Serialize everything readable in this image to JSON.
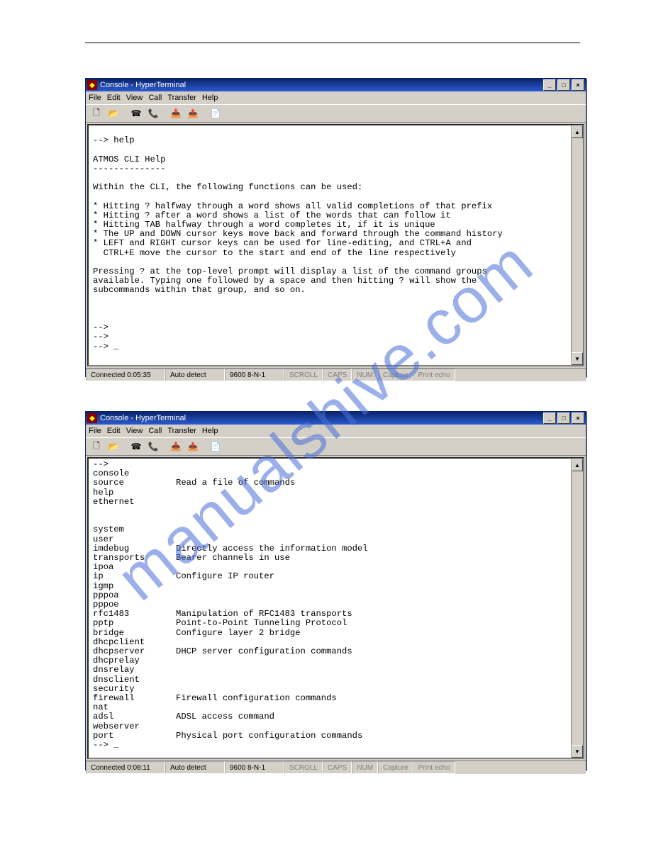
{
  "watermark": "manualshive.com",
  "window": {
    "title": "Console - HyperTerminal",
    "icon_char": "◆"
  },
  "menus": [
    "File",
    "Edit",
    "View",
    "Call",
    "Transfer",
    "Help"
  ],
  "toolbar_icons": [
    "new-icon",
    "open-icon",
    "connect-icon",
    "disconnect-icon",
    "send-icon",
    "receive-icon",
    "properties-icon"
  ],
  "toolbar_glyphs": [
    "🗋",
    "📂",
    "☎",
    "📞",
    "📥",
    "📤",
    "📄"
  ],
  "terminal1": "\n--> help\n\nATMOS CLI Help\n--------------\n\nWithin the CLI, the following functions can be used:\n\n* Hitting ? halfway through a word shows all valid completions of that prefix\n* Hitting ? after a word shows a list of the words that can follow it\n* Hitting TAB halfway through a word completes it, if it is unique\n* The UP and DOWN cursor keys move back and forward through the command history\n* LEFT and RIGHT cursor keys can be used for line-editing, and CTRL+A and\n  CTRL+E move the cursor to the start and end of the line respectively\n\nPressing ? at the top-level prompt will display a list of the command groups\navailable. Typing one followed by a space and then hitting ? will show the\nsubcommands within that group, and so on.\n\n\n\n-->\n-->\n--> _",
  "terminal2": "-->\nconsole\nsource          Read a file of commands\nhelp\nethernet\n\n\nsystem\nuser\nimdebug         Directly access the information model\ntransports      Bearer channels in use\nipoa\nip              Configure IP router\nigmp\npppoa\npppoe\nrfc1483         Manipulation of RFC1483 transports\npptp            Point-to-Point Tunneling Protocol\nbridge          Configure layer 2 bridge\ndhcpclient\ndhcpserver      DHCP server configuration commands\ndhcprelay\ndnsrelay\ndnsclient\nsecurity\nfirewall        Firewall configuration commands\nnat\nadsl            ADSL access command\nwebserver\nport            Physical port configuration commands\n--> _",
  "status1": {
    "connected": "Connected 0:05:35",
    "autodetect": "Auto detect",
    "baud": "9600 8-N-1",
    "scroll": "SCROLL",
    "caps": "CAPS",
    "num": "NUM",
    "capture": "Capture",
    "printecho": "Print echo"
  },
  "status2": {
    "connected": "Connected 0:08:11",
    "autodetect": "Auto detect",
    "baud": "9600 8-N-1",
    "scroll": "SCROLL",
    "caps": "CAPS",
    "num": "NUM",
    "capture": "Capture",
    "printecho": "Print echo"
  }
}
